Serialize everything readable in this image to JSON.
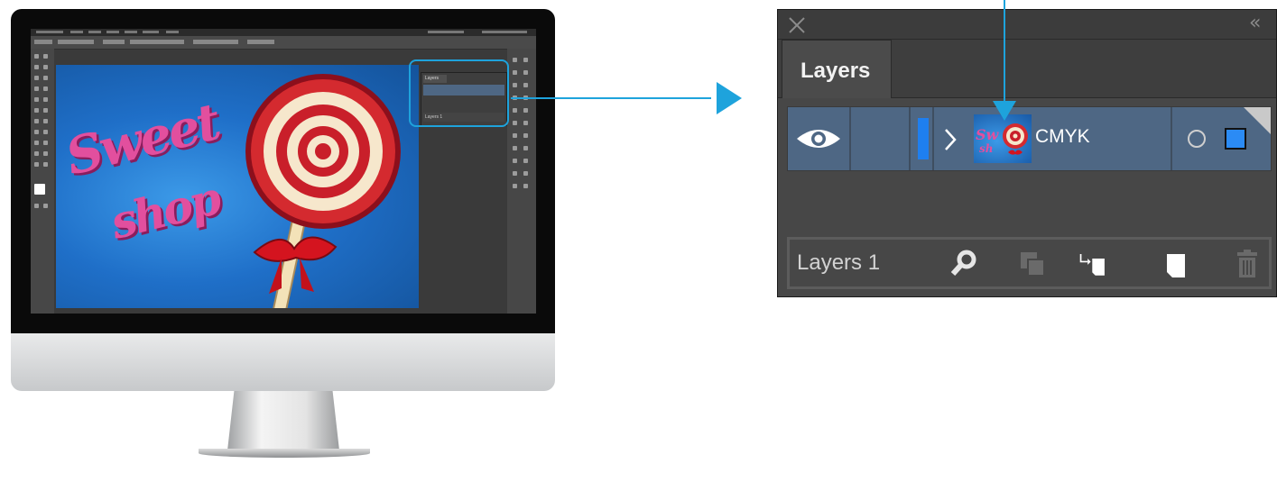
{
  "panel": {
    "tab_label": "Layers",
    "layer_row": {
      "name": "CMYK",
      "visible": true,
      "color_strip": "#1e7ff0",
      "selection_color": "#2b8bf5"
    },
    "footer": {
      "label": "Layers 1",
      "icons": [
        "locate-object-icon",
        "make-clipping-mask-icon",
        "create-sublayer-icon",
        "create-new-layer-icon",
        "delete-layer-icon"
      ]
    },
    "row_background": "#4e6784"
  },
  "artwork": {
    "line1": "Sweet",
    "line2": "shop"
  },
  "mini_panel": {
    "tab_label": "Layers",
    "footer_label": "Layers 1"
  },
  "accent_color": "#1ea3dc"
}
